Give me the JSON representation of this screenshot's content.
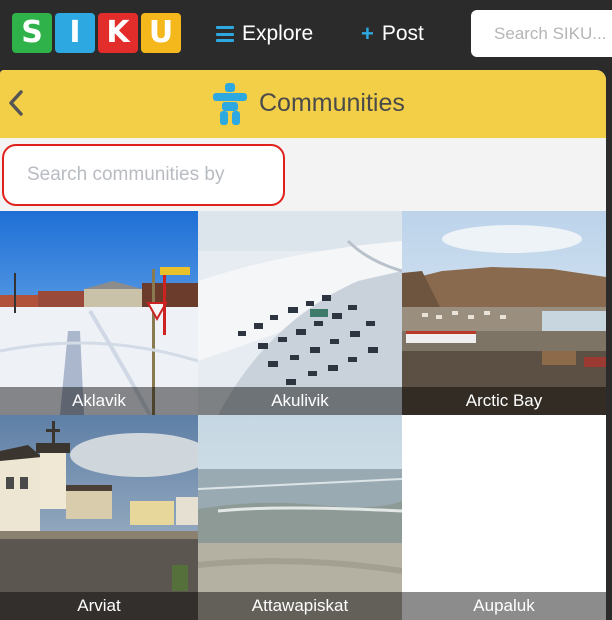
{
  "logo": {
    "letters": [
      {
        "char": "S",
        "color": "#2fb24a"
      },
      {
        "char": "I",
        "color": "#2ea8e0"
      },
      {
        "char": "K",
        "color": "#e32d2b"
      },
      {
        "char": "U",
        "color": "#f4b81c"
      }
    ]
  },
  "nav": {
    "explore_label": "Explore",
    "post_label": "Post",
    "search_placeholder": "Search SIKU..."
  },
  "panel": {
    "title": "Communities",
    "search_placeholder": "Search communities by"
  },
  "communities": [
    {
      "name": "Aklavik"
    },
    {
      "name": "Akulivik"
    },
    {
      "name": "Arctic Bay"
    },
    {
      "name": "Arviat"
    },
    {
      "name": "Attawapiskat"
    },
    {
      "name": "Aupaluk"
    }
  ],
  "colors": {
    "accent_blue": "#2ea8e0",
    "header_yellow": "#f2cf47",
    "highlight_red": "#e0201b"
  }
}
